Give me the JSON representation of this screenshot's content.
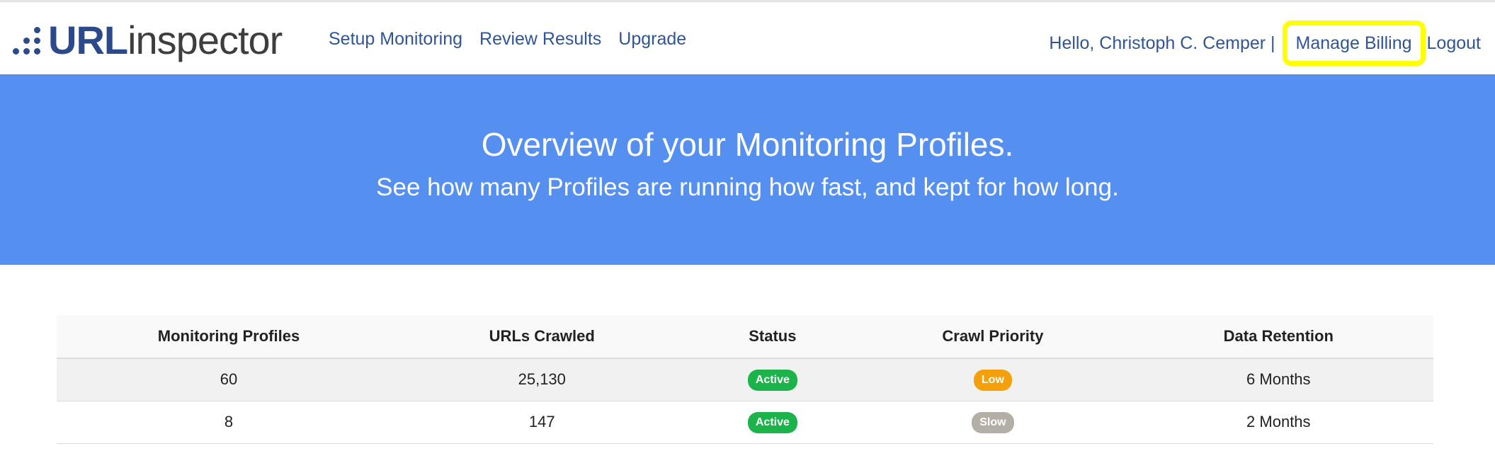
{
  "brand": {
    "name_part1": "URL",
    "name_part2": "inspector",
    "icon": "dots-logo-icon",
    "color": "#2b4a8b"
  },
  "nav": {
    "links": [
      "Setup Monitoring",
      "Review Results",
      "Upgrade"
    ]
  },
  "user": {
    "greeting": "Hello, Christoph C. Cemper |",
    "manage_billing": "Manage Billing",
    "logout": "Logout"
  },
  "hero": {
    "title": "Overview of your Monitoring Profiles.",
    "subtitle": "See how many Profiles are running how fast, and kept for how long.",
    "background": "#5590f1"
  },
  "table": {
    "headers": [
      "Monitoring Profiles",
      "URLs Crawled",
      "Status",
      "Crawl Priority",
      "Data Retention"
    ],
    "rows": [
      {
        "profiles": "60",
        "urls": "25,130",
        "status": "Active",
        "status_color": "#1bb34a",
        "priority": "Low",
        "priority_color": "#f5a00a",
        "retention": "6 Months"
      },
      {
        "profiles": "8",
        "urls": "147",
        "status": "Active",
        "status_color": "#1bb34a",
        "priority": "Slow",
        "priority_color": "#b3aea6",
        "retention": "2 Months"
      }
    ]
  },
  "highlight_color": "#ffff00"
}
